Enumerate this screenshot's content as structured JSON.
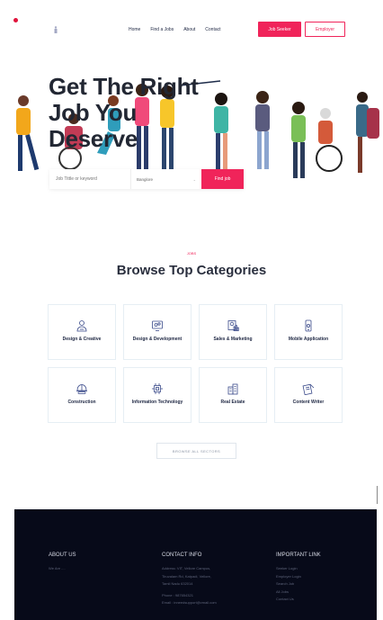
{
  "header": {
    "logo_icon": "figure-logo-icon",
    "nav": [
      "Home",
      "Find a Jobs",
      "About",
      "Contact"
    ],
    "job_seeker_label": "Job Seeker",
    "employer_label": "Employer"
  },
  "hero": {
    "title": "Get The Right Job You Deserve",
    "search_placeholder": "Job Tittle or keyword",
    "location_selected": "Banglore",
    "find_button": "Find job"
  },
  "categories": {
    "tag": "JOBS",
    "title": "Browse Top Categories",
    "items": [
      {
        "label": "Design & Creative",
        "icon": "designer-icon"
      },
      {
        "label": "Design & Development",
        "icon": "monitor-gears-icon"
      },
      {
        "label": "Sales & Marketing",
        "icon": "chart-document-icon"
      },
      {
        "label": "Mobile Application",
        "icon": "mobile-gear-icon"
      },
      {
        "label": "Construction",
        "icon": "hard-hat-icon"
      },
      {
        "label": "Information Technology",
        "icon": "chip-icon"
      },
      {
        "label": "Real Estate",
        "icon": "buildings-icon"
      },
      {
        "label": "Content Writer",
        "icon": "document-pen-icon"
      }
    ],
    "browse_all": "BROWSE ALL SECTORS"
  },
  "footer": {
    "about_title": "ABOUT US",
    "about_text": "We Are ....",
    "contact_title": "CONTACT INFO",
    "contact_lines": [
      "Address: VIT, Vellore Campus,",
      "Tiruvalam Rd, Katpadi, Vellore,",
      "Tamil Nadu 632014"
    ],
    "phone": "Phone : 987654321",
    "email": "Email : inneedsupport@vmail.com",
    "links_title": "IMPORTANT LINK",
    "links": [
      "Seeker Login",
      "Employer Login",
      "Search Job",
      "All Jobs",
      "Contact Us"
    ]
  },
  "colors": {
    "accent": "#f0245a",
    "footer_bg": "#070a19",
    "icon": "#3a4a8a"
  }
}
